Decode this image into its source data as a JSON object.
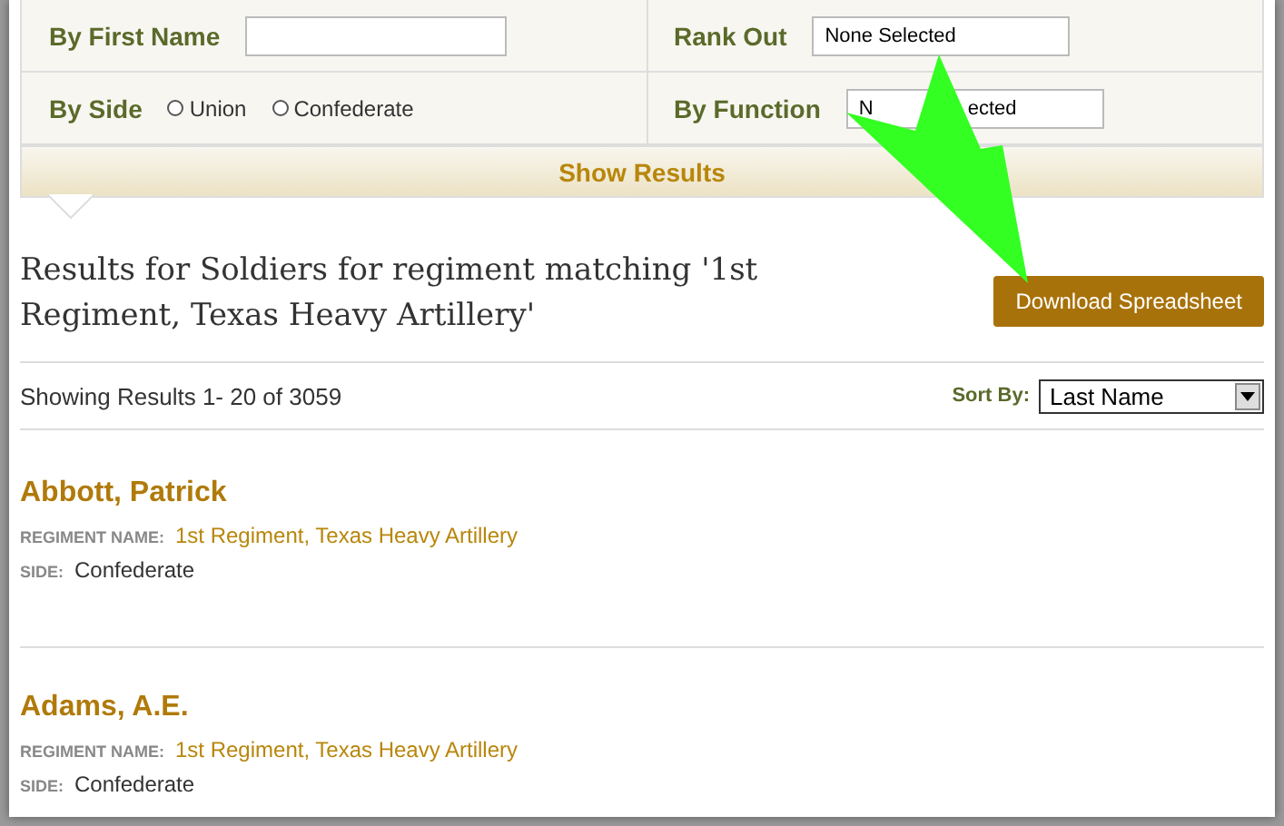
{
  "filters": [
    {
      "label": "By First Name",
      "kind": "text"
    },
    {
      "label": "Rank Out",
      "kind": "select",
      "value": "None Selected"
    },
    {
      "label": "By Side",
      "kind": "radio",
      "options": [
        {
          "label": "Union",
          "selected": false
        },
        {
          "label": "Confederate",
          "selected": false
        }
      ]
    },
    {
      "label": "By Function",
      "kind": "select",
      "value_parts": [
        "N",
        "ected"
      ]
    }
  ],
  "show_results": "Show Results",
  "heading": "Results for Soldiers for regiment matching '1st Regiment, Texas Heavy Artillery'",
  "download_button": "Download Spreadsheet",
  "summary": "Showing Results 1- 20 of 3059",
  "sort": {
    "label": "Sort By:",
    "value": "Last Name"
  },
  "results": [
    {
      "name": "Abbott, Patrick",
      "fields": [
        {
          "label": "REGIMENT NAME:",
          "value": "1st Regiment, Texas Heavy Artillery",
          "kind": "link"
        },
        {
          "label": "SIDE:",
          "value": "Confederate",
          "kind": "text"
        }
      ]
    },
    {
      "name": "Adams, A.E.",
      "fields": [
        {
          "label": "REGIMENT NAME:",
          "value": "1st Regiment, Texas Heavy Artillery",
          "kind": "link"
        },
        {
          "label": "SIDE:",
          "value": "Confederate",
          "kind": "text"
        }
      ]
    }
  ]
}
